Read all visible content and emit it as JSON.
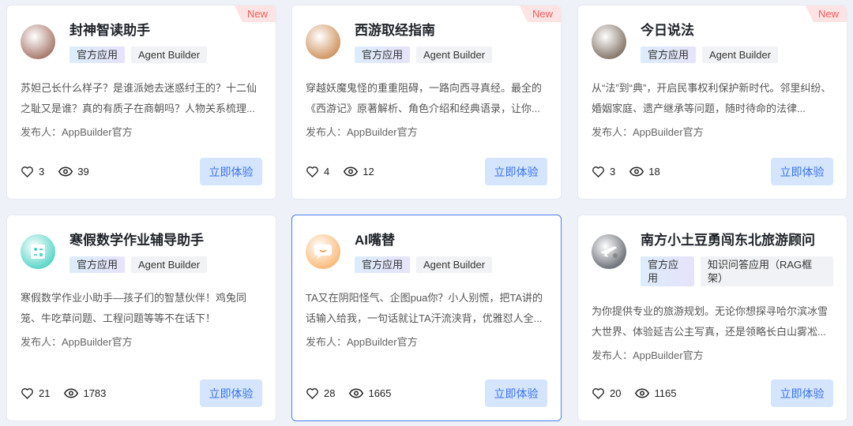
{
  "common": {
    "tag_official": "官方应用",
    "tag_agent": "Agent Builder",
    "button": "立即体验",
    "new_badge": "New",
    "publisher": "发布人：AppBuilder官方"
  },
  "cards": [
    {
      "title": "封神智读助手",
      "desc": "苏妲己长什么样子？是谁派她去迷惑纣王的？十二仙之耻又是谁？真的有质子在商朝吗？人物关系梳理...",
      "likes": "3",
      "views": "39",
      "is_new": true,
      "avatar_color": "#8a4a3a"
    },
    {
      "title": "西游取经指南",
      "desc": "穿越妖魔鬼怪的重重阻碍，一路向西寻真经。最全的《西游记》原著解析、角色介绍和经典语录，让你...",
      "likes": "4",
      "views": "12",
      "is_new": true,
      "avatar_color": "#c0702a"
    },
    {
      "title": "今日说法",
      "desc": "从“法”到“典”，开启民事权利保护新时代。邻里纠纷、婚姻家庭、遗产继承等问题，随时待命的法律...",
      "likes": "3",
      "views": "18",
      "is_new": true,
      "avatar_color": "#5a4636"
    },
    {
      "title": "寒假数学作业辅导助手",
      "desc": "寒假数学作业小助手—孩子们的智慧伙伴！鸡兔同笼、牛吃草问题、工程问题等等不在话下！",
      "likes": "21",
      "views": "1783",
      "avatar_color": "#1fc7b5"
    },
    {
      "title": "AI嘴替",
      "desc": "TA又在阴阳怪气、企图pua你？小人别慌，把TA讲的话输入给我，一句话就让TA汗流浃背，优雅怼人全...",
      "likes": "28",
      "views": "1665",
      "avatar_color": "#f7a24a"
    },
    {
      "title": "南方小土豆勇闯东北旅游顾问",
      "tag2": "知识问答应用（RAG框架）",
      "desc": "为你提供专业的旅游规划。无论你想探寻哈尔滨冰雪大世界、体验延吉公主写真，还是领略长白山雾凇...",
      "likes": "20",
      "views": "1165",
      "avatar_color": "#3a3f4a"
    }
  ]
}
